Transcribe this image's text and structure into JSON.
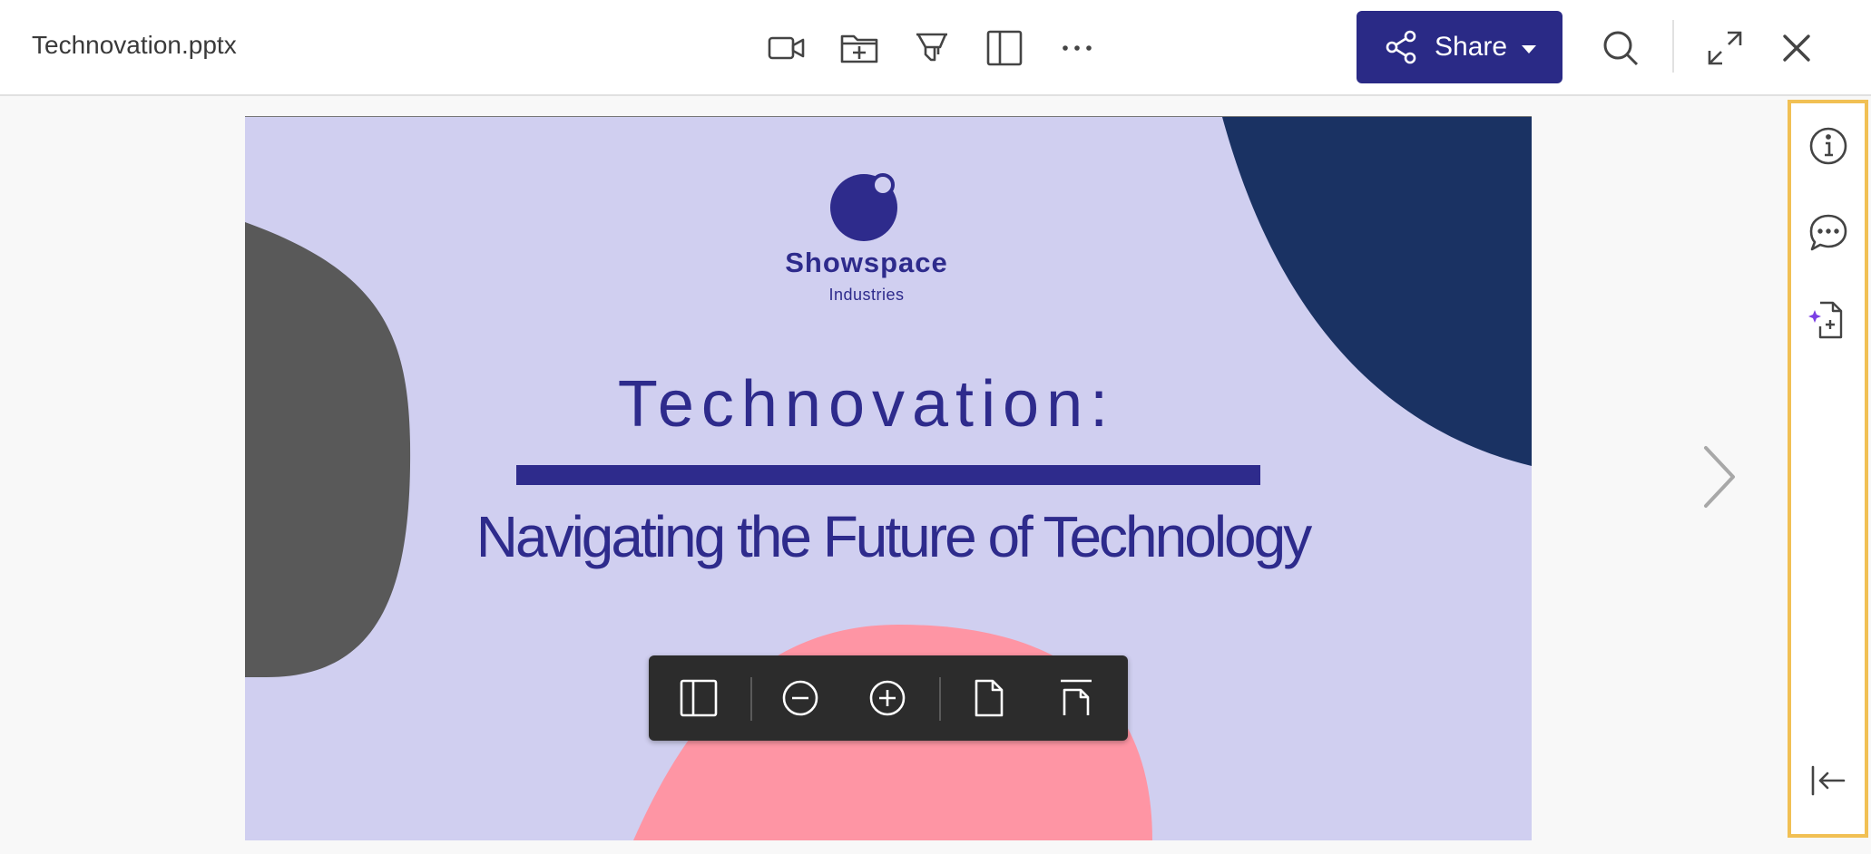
{
  "header": {
    "filename": "Technovation.pptx",
    "tools": [
      "video-icon",
      "add-to-folder-icon",
      "highlighter-icon",
      "panel-icon",
      "more-icon"
    ],
    "share_label": "Share",
    "right_tools": [
      "search-icon",
      "expand-icon",
      "close-icon"
    ]
  },
  "slide": {
    "logo_name": "Showspace",
    "logo_sub": "Industries",
    "title": "Technovation:",
    "subtitle": "Navigating the Future of Technology",
    "colors": {
      "background": "#d0cff0",
      "primary": "#2e2b8c",
      "navy": "#1a3263",
      "gray": "#595959",
      "pink": "#fe95a4"
    }
  },
  "zoom_toolbar": {
    "buttons": [
      "thumbnails-icon",
      "zoom-out-icon",
      "zoom-in-icon",
      "fit-page-icon",
      "fit-width-icon"
    ]
  },
  "right_panel": {
    "buttons": [
      "info-icon",
      "comments-icon",
      "ai-document-icon",
      "collapse-panel-icon"
    ],
    "accent": "#f1c054"
  },
  "colors": {
    "share_button": "#2a2a86"
  }
}
